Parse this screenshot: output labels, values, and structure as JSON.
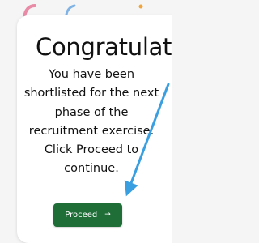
{
  "card": {
    "title": "Congratulations",
    "message": "You have been shortlisted for the next phase of the recruitment exercise. Click Proceed to continue.",
    "proceed_label": "Proceed",
    "proceed_icon": "→"
  },
  "colors": {
    "button": "#1f6e38",
    "pointer_arrow": "#3a9fe0",
    "confetti_pink": "#e98aa6",
    "confetti_blue": "#7fb3e6",
    "confetti_orange": "#f0a43a"
  }
}
